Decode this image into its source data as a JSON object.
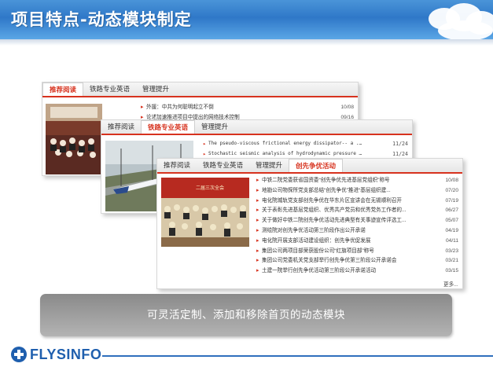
{
  "header": {
    "title": "项目特点-动态模块制定"
  },
  "panel1": {
    "tabs": [
      "推荐阅读",
      "铁路专业英语",
      "管理提升"
    ],
    "active_tab": 0,
    "items": [
      {
        "title": "外援：中共为何聪明起立不倒",
        "date": "10/08"
      },
      {
        "title": "论述加速推进项目中提出的网络技术控制",
        "date": "09/16"
      }
    ]
  },
  "panel2": {
    "tabs": [
      "推荐阅读",
      "铁路专业英语",
      "管理提升"
    ],
    "active_tab": 1,
    "items": [
      {
        "title": "The pseudo-viscous frictional energy dissipator-- a ...",
        "date": "11/24"
      },
      {
        "title": "Stochastic seismic analysis of hydrodynamic pressure ...",
        "date": "11/24"
      }
    ]
  },
  "panel3": {
    "tabs": [
      "推荐阅读",
      "铁路专业英语",
      "管理提升",
      "创先争优活动"
    ],
    "active_tab": 3,
    "photo_caption": "二届三次全会",
    "items": [
      {
        "title": "中铁二院党委获省国资委“创先争优先进基层党组织”称号",
        "date": "10/08"
      },
      {
        "title": "地勘公司物探所党支部总结“创先争优”推进“基层组织建...",
        "date": "07/20"
      },
      {
        "title": "电化院城轨党支部创先争优在华东片区宣讲会在无锡顺利召开",
        "date": "07/19"
      },
      {
        "title": "关于表彰先进基层党组织、优秀共产党员和优秀党务工作者的...",
        "date": "06/27"
      },
      {
        "title": "关于做好中铁二院创先争优活动先进典型有关事迹宣传评选工...",
        "date": "05/07"
      },
      {
        "title": "测绘院对创先争优活动第三阶段作出公开承诺",
        "date": "04/19"
      },
      {
        "title": "电化院开展支部活动建设组织：创先争优促发展",
        "date": "04/11"
      },
      {
        "title": "集团公司两项目部荣获股份公司“红旗项目部”称号",
        "date": "03/23"
      },
      {
        "title": "集团公司党委机关党支部举行创先争优第三阶段公开承诺会",
        "date": "03/21"
      },
      {
        "title": "土建一院举行创先争优活动第三阶段公开承诺活动",
        "date": "03/15"
      }
    ],
    "more_label": "更多..."
  },
  "caption": "可灵活定制、添加和移除首页的动态模块",
  "footer": {
    "logo_text": "FLYSINFO"
  },
  "colors": {
    "accent": "#d7321e",
    "banner": "#3a86d4",
    "logo": "#1f5fae"
  }
}
